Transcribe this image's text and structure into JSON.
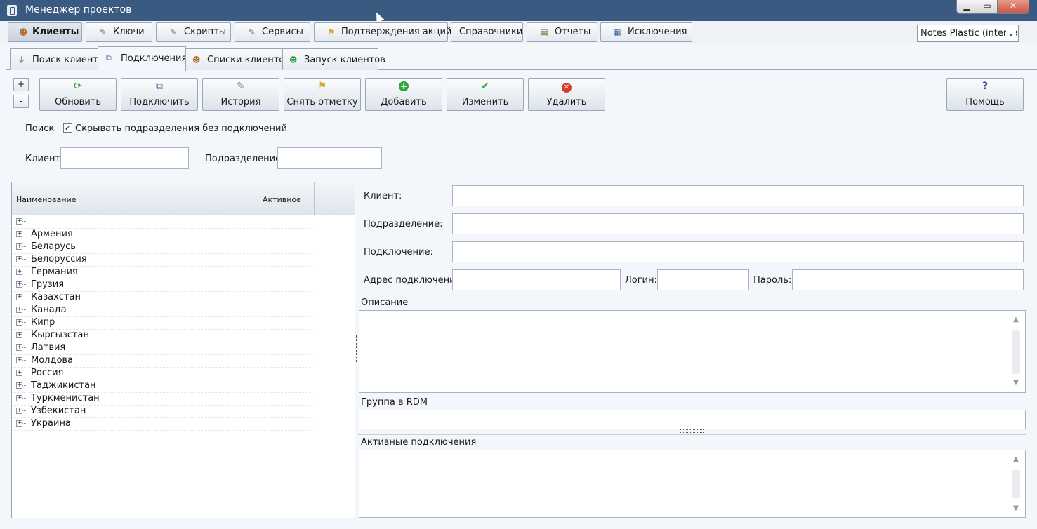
{
  "window": {
    "title": "Менеджер проектов",
    "controls": {
      "minimize": "▁",
      "maximize": "▭",
      "close": "✕"
    }
  },
  "main_tabs": [
    {
      "label": "Клиенты",
      "icon": "users-icon"
    },
    {
      "label": "Ключи",
      "icon": "wrench-icon"
    },
    {
      "label": "Скрипты",
      "icon": "script-icon"
    },
    {
      "label": "Сервисы",
      "icon": "wrench-icon"
    },
    {
      "label": "Подтверждения акций",
      "icon": "broom-icon"
    },
    {
      "label": "Справочники",
      "icon": ""
    },
    {
      "label": "Отчеты",
      "icon": "report-icon"
    },
    {
      "label": "Исключения",
      "icon": "grid-icon"
    }
  ],
  "db_select": {
    "value": "Notes Plastic (interna",
    "chevron": "⌄"
  },
  "sub_tabs": [
    {
      "label": "Поиск клиента",
      "icon": "filter-icon"
    },
    {
      "label": "Подключения",
      "icon": "connection-icon"
    },
    {
      "label": "Списки клиентов",
      "icon": "users-icon"
    },
    {
      "label": "Запуск клиентов",
      "icon": "user-add-icon"
    }
  ],
  "expand_buttons": {
    "plus": "+",
    "minus": "-"
  },
  "toolbar": [
    {
      "label": "Обновить",
      "icon": "refresh-icon",
      "glyph": "⟳"
    },
    {
      "label": "Подключить",
      "icon": "connect-icon",
      "glyph": "⧉"
    },
    {
      "label": "История",
      "icon": "history-icon",
      "glyph": "✎"
    },
    {
      "label": "Снять отметку",
      "icon": "broom-icon",
      "glyph": "⚑"
    },
    {
      "label": "Добавить",
      "icon": "add-icon",
      "glyph": "+"
    },
    {
      "label": "Изменить",
      "icon": "check-icon",
      "glyph": "✔"
    },
    {
      "label": "Удалить",
      "icon": "delete-icon",
      "glyph": "✕"
    }
  ],
  "help_button": {
    "label": "Помощь",
    "glyph": "?"
  },
  "search": {
    "label": "Поиск",
    "hide_checkbox_label": "Скрывать подразделения без подключений",
    "hide_checked": "✓",
    "client_label": "Клиент:",
    "client_value": "",
    "division_label": "Подразделение:",
    "division_value": ""
  },
  "tree": {
    "columns": [
      "Наименование",
      "Активное"
    ],
    "rows": [
      "",
      "Армения",
      "Беларусь",
      "Белоруссия",
      "Германия",
      "Грузия",
      "Казахстан",
      "Канада",
      "Кипр",
      "Кыргызстан",
      "Латвия",
      "Молдова",
      "Россия",
      "Таджикистан",
      "Туркменистан",
      "Узбекистан",
      "Украина"
    ]
  },
  "details": {
    "client_label": "Клиент:",
    "division_label": "Подразделение:",
    "connection_label": "Подключение:",
    "address_label": "Адрес подключения",
    "login_label": "Логин:",
    "password_label": "Пароль:",
    "description_label": "Описание",
    "rdm_group_label": "Группа в RDM",
    "active_connections_label": "Активные подключения"
  }
}
